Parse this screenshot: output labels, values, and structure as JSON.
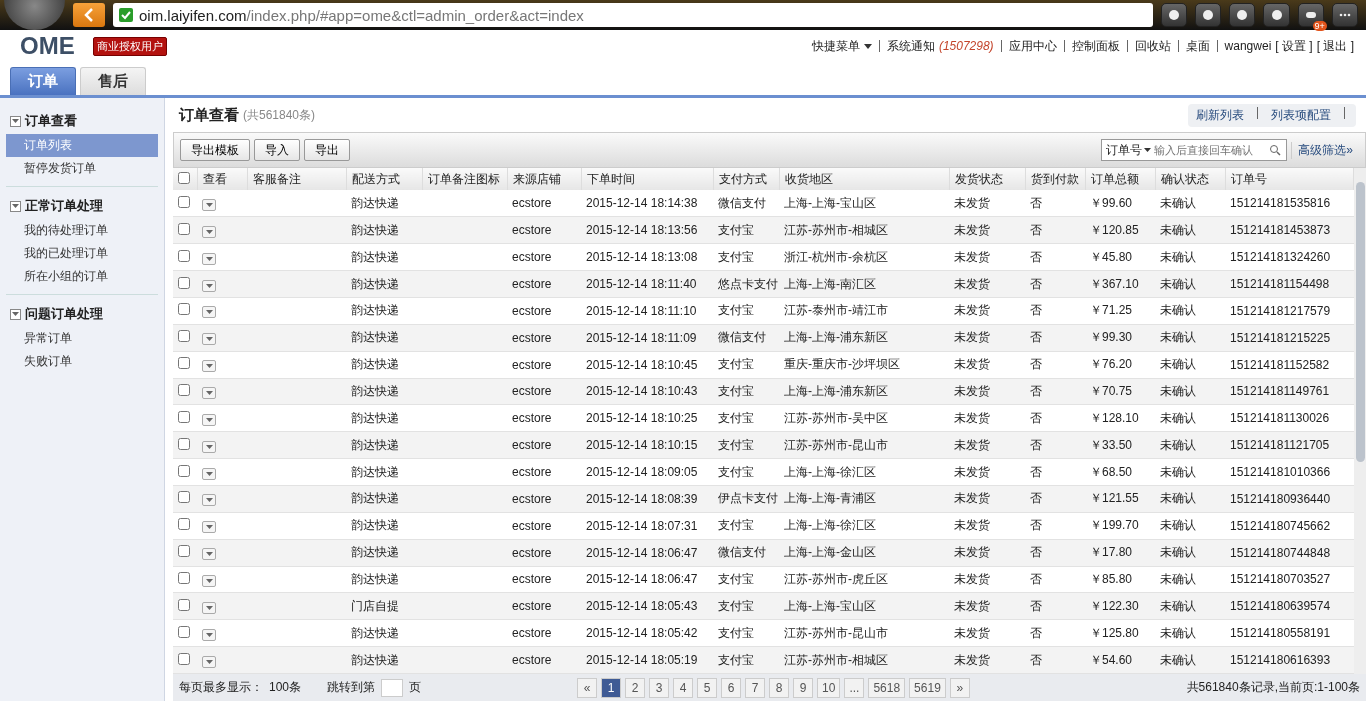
{
  "browser": {
    "url_host": "oim.laiyifen.com",
    "url_path": "/index.php/#app=ome&ctl=admin_order&act=index",
    "badge": "9+"
  },
  "header": {
    "logo": "OME",
    "license": "商业授权用户",
    "menu": "快捷菜单",
    "notice_label": "系统通知",
    "notice_count": "(1507298)",
    "links": [
      "应用中心",
      "控制面板",
      "回收站",
      "桌面"
    ],
    "user": "wangwei",
    "user_links": [
      "[ 设置 ]",
      "[ 退出 ]"
    ]
  },
  "tabs": [
    {
      "label": "订单",
      "selected": true
    },
    {
      "label": "售后",
      "selected": false
    }
  ],
  "sidebar": [
    {
      "title": "订单查看",
      "expanded": true,
      "items": [
        {
          "label": "订单列表",
          "selected": true
        },
        {
          "label": "暂停发货订单",
          "selected": false
        }
      ]
    },
    {
      "title": "正常订单处理",
      "expanded": true,
      "items": [
        {
          "label": "我的待处理订单",
          "selected": false
        },
        {
          "label": "我的已处理订单",
          "selected": false
        },
        {
          "label": "所在小组的订单",
          "selected": false
        }
      ]
    },
    {
      "title": "问题订单处理",
      "expanded": true,
      "items": [
        {
          "label": "异常订单",
          "selected": false
        },
        {
          "label": "失败订单",
          "selected": false
        }
      ]
    }
  ],
  "page": {
    "title": "订单查看",
    "count": "(共561840条)",
    "actions": [
      "刷新列表",
      "列表项配置"
    ],
    "buttons": [
      "导出模板",
      "导入",
      "导出"
    ],
    "search_field": "订单号",
    "search_placeholder": "输入后直接回车确认",
    "advanced": "高级筛选»"
  },
  "table": {
    "select_all_checked": false,
    "columns": [
      "查看",
      "客服备注",
      "配送方式",
      "订单备注图标",
      "来源店铺",
      "下单时间",
      "支付方式",
      "收货地区",
      "发货状态",
      "货到付款",
      "订单总额",
      "确认状态",
      "订单号"
    ],
    "rows": [
      {
        "checked": false,
        "cells": [
          "",
          "",
          "韵达快递",
          "",
          "ecstore",
          "2015-12-14 18:14:38",
          "微信支付",
          "上海-上海-宝山区",
          "未发货",
          "否",
          "￥99.60",
          "未确认",
          "151214181535816"
        ]
      },
      {
        "checked": false,
        "cells": [
          "",
          "",
          "韵达快递",
          "",
          "ecstore",
          "2015-12-14 18:13:56",
          "支付宝",
          "江苏-苏州市-相城区",
          "未发货",
          "否",
          "￥120.85",
          "未确认",
          "151214181453873"
        ]
      },
      {
        "checked": false,
        "cells": [
          "",
          "",
          "韵达快递",
          "",
          "ecstore",
          "2015-12-14 18:13:08",
          "支付宝",
          "浙江-杭州市-余杭区",
          "未发货",
          "否",
          "￥45.80",
          "未确认",
          "151214181324260"
        ]
      },
      {
        "checked": false,
        "cells": [
          "",
          "",
          "韵达快递",
          "",
          "ecstore",
          "2015-12-14 18:11:40",
          "悠点卡支付",
          "上海-上海-南汇区",
          "未发货",
          "否",
          "￥367.10",
          "未确认",
          "151214181154498"
        ]
      },
      {
        "checked": false,
        "cells": [
          "",
          "",
          "韵达快递",
          "",
          "ecstore",
          "2015-12-14 18:11:10",
          "支付宝",
          "江苏-泰州市-靖江市",
          "未发货",
          "否",
          "￥71.25",
          "未确认",
          "151214181217579"
        ]
      },
      {
        "checked": false,
        "cells": [
          "",
          "",
          "韵达快递",
          "",
          "ecstore",
          "2015-12-14 18:11:09",
          "微信支付",
          "上海-上海-浦东新区",
          "未发货",
          "否",
          "￥99.30",
          "未确认",
          "151214181215225"
        ]
      },
      {
        "checked": false,
        "cells": [
          "",
          "",
          "韵达快递",
          "",
          "ecstore",
          "2015-12-14 18:10:45",
          "支付宝",
          "重庆-重庆市-沙坪坝区",
          "未发货",
          "否",
          "￥76.20",
          "未确认",
          "151214181152582"
        ]
      },
      {
        "checked": false,
        "cells": [
          "",
          "",
          "韵达快递",
          "",
          "ecstore",
          "2015-12-14 18:10:43",
          "支付宝",
          "上海-上海-浦东新区",
          "未发货",
          "否",
          "￥70.75",
          "未确认",
          "151214181149761"
        ]
      },
      {
        "checked": false,
        "cells": [
          "",
          "",
          "韵达快递",
          "",
          "ecstore",
          "2015-12-14 18:10:25",
          "支付宝",
          "江苏-苏州市-吴中区",
          "未发货",
          "否",
          "￥128.10",
          "未确认",
          "151214181130026"
        ]
      },
      {
        "checked": false,
        "cells": [
          "",
          "",
          "韵达快递",
          "",
          "ecstore",
          "2015-12-14 18:10:15",
          "支付宝",
          "江苏-苏州市-昆山市",
          "未发货",
          "否",
          "￥33.50",
          "未确认",
          "151214181121705"
        ]
      },
      {
        "checked": false,
        "cells": [
          "",
          "",
          "韵达快递",
          "",
          "ecstore",
          "2015-12-14 18:09:05",
          "支付宝",
          "上海-上海-徐汇区",
          "未发货",
          "否",
          "￥68.50",
          "未确认",
          "151214181010366"
        ]
      },
      {
        "checked": false,
        "cells": [
          "",
          "",
          "韵达快递",
          "",
          "ecstore",
          "2015-12-14 18:08:39",
          "伊点卡支付",
          "上海-上海-青浦区",
          "未发货",
          "否",
          "￥121.55",
          "未确认",
          "151214180936440"
        ]
      },
      {
        "checked": false,
        "cells": [
          "",
          "",
          "韵达快递",
          "",
          "ecstore",
          "2015-12-14 18:07:31",
          "支付宝",
          "上海-上海-徐汇区",
          "未发货",
          "否",
          "￥199.70",
          "未确认",
          "151214180745662"
        ]
      },
      {
        "checked": false,
        "cells": [
          "",
          "",
          "韵达快递",
          "",
          "ecstore",
          "2015-12-14 18:06:47",
          "微信支付",
          "上海-上海-金山区",
          "未发货",
          "否",
          "￥17.80",
          "未确认",
          "151214180744848"
        ]
      },
      {
        "checked": false,
        "cells": [
          "",
          "",
          "韵达快递",
          "",
          "ecstore",
          "2015-12-14 18:06:47",
          "支付宝",
          "江苏-苏州市-虎丘区",
          "未发货",
          "否",
          "￥85.80",
          "未确认",
          "151214180703527"
        ]
      },
      {
        "checked": false,
        "cells": [
          "",
          "",
          "门店自提",
          "",
          "ecstore",
          "2015-12-14 18:05:43",
          "支付宝",
          "上海-上海-宝山区",
          "未发货",
          "否",
          "￥122.30",
          "未确认",
          "151214180639574"
        ]
      },
      {
        "checked": false,
        "cells": [
          "",
          "",
          "韵达快递",
          "",
          "ecstore",
          "2015-12-14 18:05:42",
          "支付宝",
          "江苏-苏州市-昆山市",
          "未发货",
          "否",
          "￥125.80",
          "未确认",
          "151214180558191"
        ]
      },
      {
        "checked": false,
        "cells": [
          "",
          "",
          "韵达快递",
          "",
          "ecstore",
          "2015-12-14 18:05:19",
          "支付宝",
          "江苏-苏州市-相城区",
          "未发货",
          "否",
          "￥54.60",
          "未确认",
          "151214180616393"
        ]
      }
    ]
  },
  "footer": {
    "per_page_label": "每页最多显示：",
    "per_page": "100条",
    "jump_label": "跳转到第",
    "jump_suffix": "页",
    "prev": "«",
    "pages": [
      {
        "label": "1",
        "selected": true
      },
      {
        "label": "2",
        "selected": false
      },
      {
        "label": "3",
        "selected": false
      },
      {
        "label": "4",
        "selected": false
      },
      {
        "label": "5",
        "selected": false
      },
      {
        "label": "6",
        "selected": false
      },
      {
        "label": "7",
        "selected": false
      },
      {
        "label": "8",
        "selected": false
      },
      {
        "label": "9",
        "selected": false
      },
      {
        "label": "10",
        "selected": false
      },
      {
        "label": "...",
        "selected": false
      },
      {
        "label": "5618",
        "selected": false
      },
      {
        "label": "5619",
        "selected": false
      }
    ],
    "next": "»",
    "summary": "共561840条记录,当前页:1-100条"
  }
}
